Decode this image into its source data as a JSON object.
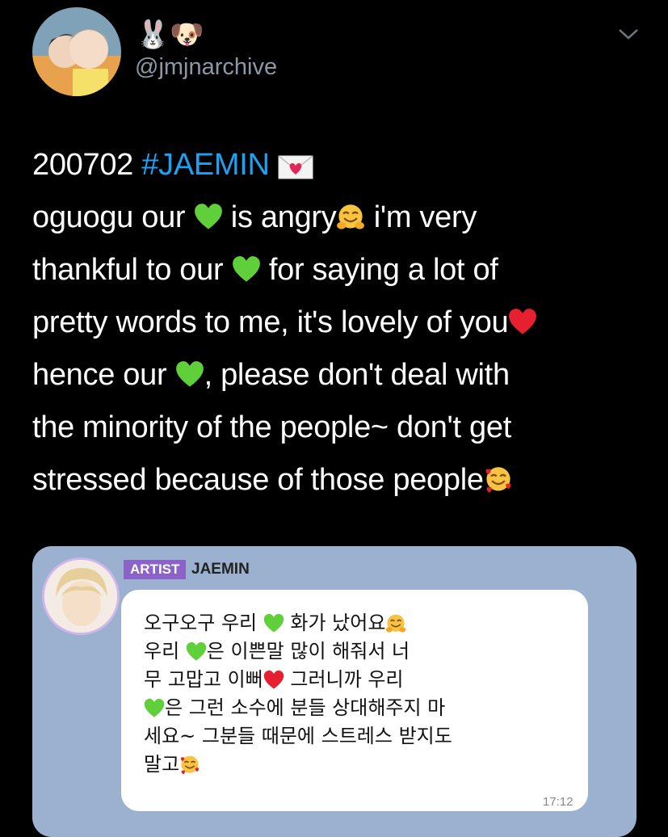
{
  "author": {
    "display_name_emoji": "🐰🐶",
    "handle": "@jmjnarchive"
  },
  "tweet": {
    "date": "200702",
    "hashtag": "#JAEMIN",
    "lines": [
      [
        "oguogu our ",
        "HEART_GREEN",
        " is angry",
        "HUG",
        " i'm very"
      ],
      [
        "thankful to our ",
        "HEART_GREEN",
        " for saying a lot of"
      ],
      [
        "pretty words to me, it's lovely of you",
        "HEART_RED"
      ],
      [
        "hence our ",
        "HEART_GREEN",
        ", please don't deal with"
      ],
      [
        "the minority of the people~ don't get"
      ],
      [
        "stressed because of those people",
        "SMILE"
      ]
    ]
  },
  "media": {
    "badge": "ARTIST",
    "artist_name": "JAEMIN",
    "message_lines": [
      [
        "오구오구 우리       ",
        "HEART_GREEN",
        " 화가 났어요",
        "HUG"
      ],
      [
        "우리       ",
        "HEART_GREEN",
        "은 이쁜말 많이 해줘서 너"
      ],
      [
        "무 고맙고 이뻐",
        "HEART_RED",
        " 그러니까 우리"
      ],
      [
        "HEART_GREEN",
        "은 그런 소수에 분들 상대해주지 마"
      ],
      [
        "세요~ 그분들 때문에 스트레스 받지도"
      ],
      [
        "말고",
        "SMILE"
      ]
    ],
    "time": "17:12"
  },
  "colors": {
    "hashtag": "#1da1f2",
    "handle": "#8b98a5",
    "media_background": "#9bb1cf",
    "badge": "#8b62c7"
  }
}
